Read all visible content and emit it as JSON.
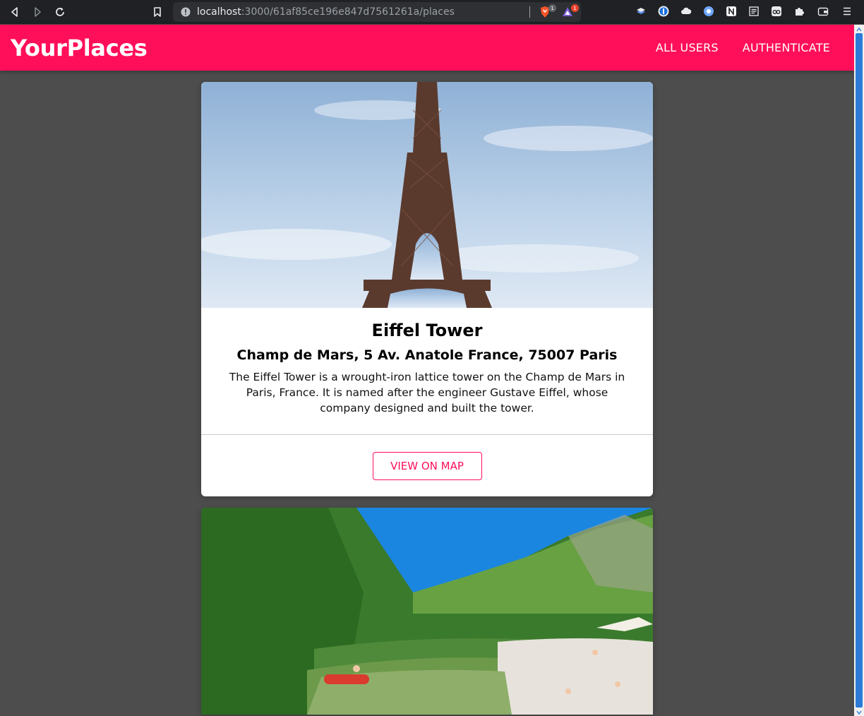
{
  "browser": {
    "url_host": "localhost",
    "url_path": ":3000/61af85ce196e847d7561261a/places",
    "shields_count": "1",
    "rewards_count": "1"
  },
  "header": {
    "brand": "YourPlaces",
    "nav": [
      {
        "label": "ALL USERS"
      },
      {
        "label": "AUTHENTICATE"
      }
    ]
  },
  "places": [
    {
      "title": "Eiffel Tower",
      "address": "Champ de Mars, 5 Av. Anatole France, 75007 Paris",
      "description": "The Eiffel Tower is a wrought-iron lattice tower on the Champ de Mars in Paris, France. It is named after the engineer Gustave Eiffel, whose company designed and built the tower.",
      "action_label": "VIEW ON MAP"
    }
  ],
  "colors": {
    "brand": "#ff0f59",
    "background": "#4d4d4d",
    "card": "#ffffff"
  }
}
